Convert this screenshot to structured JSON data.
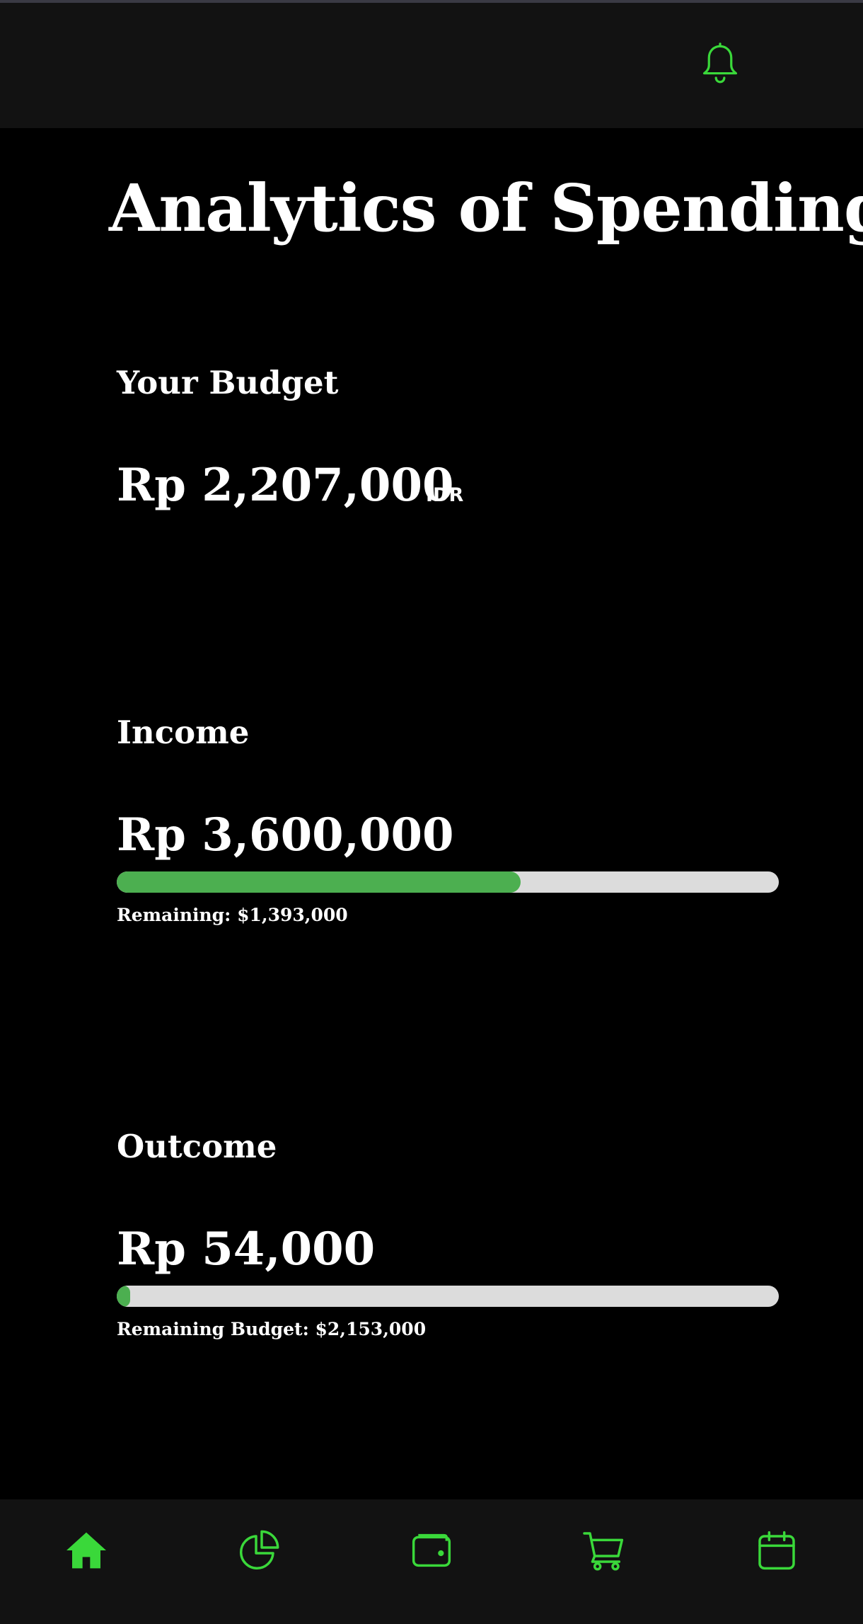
{
  "header": {
    "notification_icon": "bell-icon"
  },
  "page": {
    "title": "Analytics of Spending"
  },
  "budget": {
    "label": "Your Budget",
    "amount": "Rp 2,207,000",
    "currency": "IDR"
  },
  "income": {
    "label": "Income",
    "amount": "Rp 3,600,000",
    "progress_percent": 61,
    "remaining_text": "Remaining: $1,393,000"
  },
  "outcome": {
    "label": "Outcome",
    "amount": "Rp 54,000",
    "progress_percent": 2,
    "remaining_text": "Remaining Budget: $2,153,000"
  },
  "nav": {
    "items": [
      {
        "icon": "home-icon",
        "active": true
      },
      {
        "icon": "pie-chart-icon",
        "active": false
      },
      {
        "icon": "wallet-icon",
        "active": false
      },
      {
        "icon": "cart-icon",
        "active": false
      },
      {
        "icon": "calendar-icon",
        "active": false
      }
    ]
  },
  "colors": {
    "accent": "#3ad83a",
    "progress_fill": "#4caf50",
    "progress_track": "#dcdcdc",
    "bar_background": "#121212",
    "page_background": "#000000"
  }
}
